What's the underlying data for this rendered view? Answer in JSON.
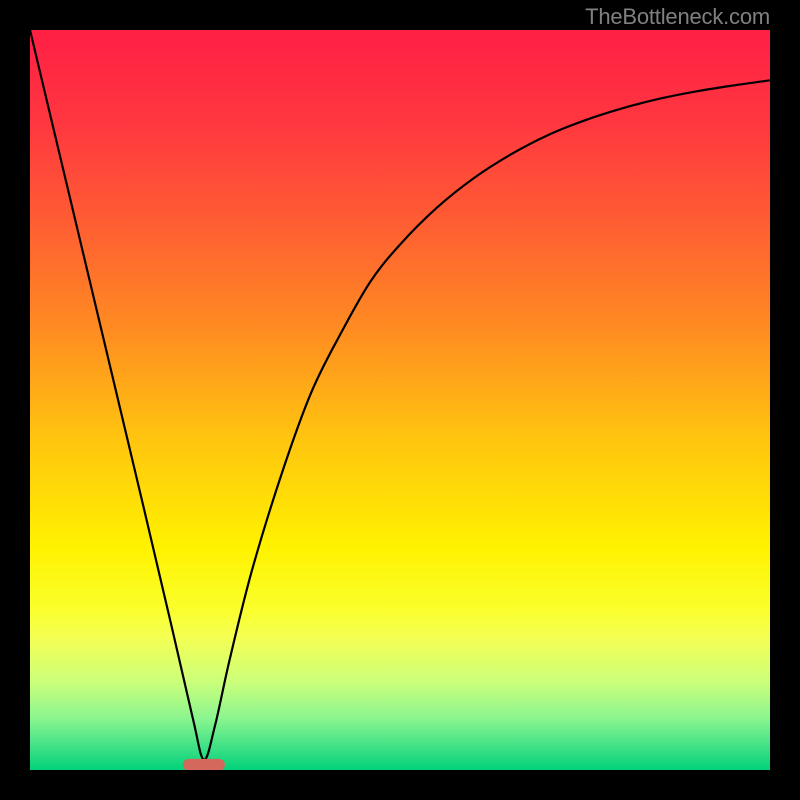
{
  "watermark": "TheBottleneck.com",
  "chart_data": {
    "type": "line",
    "title": "",
    "xlabel": "",
    "ylabel": "",
    "xlim": [
      0,
      100
    ],
    "ylim": [
      0,
      100
    ],
    "series": [
      {
        "name": "curve",
        "x": [
          0,
          5,
          10,
          15,
          19,
          22,
          23.5,
          25,
          27,
          30,
          34,
          38,
          42,
          46,
          50,
          55,
          60,
          65,
          70,
          75,
          80,
          85,
          90,
          95,
          100
        ],
        "y": [
          100,
          79,
          58,
          37,
          20,
          7,
          1.4,
          6,
          15,
          27,
          40,
          51,
          59,
          66,
          71,
          76,
          80,
          83.2,
          85.8,
          87.8,
          89.4,
          90.7,
          91.7,
          92.5,
          93.2
        ]
      }
    ],
    "annotations": [
      {
        "name": "marker",
        "x": 23.5,
        "y": 0.7,
        "color": "#d4685d"
      }
    ],
    "background_gradient": {
      "stops": [
        {
          "offset": 0.0,
          "color": "#ff1f44"
        },
        {
          "offset": 0.12,
          "color": "#ff3640"
        },
        {
          "offset": 0.25,
          "color": "#ff5a34"
        },
        {
          "offset": 0.4,
          "color": "#ff8a22"
        },
        {
          "offset": 0.55,
          "color": "#ffc40f"
        },
        {
          "offset": 0.7,
          "color": "#fff200"
        },
        {
          "offset": 0.78,
          "color": "#faff2a"
        },
        {
          "offset": 0.82,
          "color": "#f5ff52"
        },
        {
          "offset": 0.88,
          "color": "#ccff7a"
        },
        {
          "offset": 0.93,
          "color": "#8bf58f"
        },
        {
          "offset": 0.97,
          "color": "#3de085"
        },
        {
          "offset": 1.0,
          "color": "#00d27a"
        }
      ]
    }
  }
}
